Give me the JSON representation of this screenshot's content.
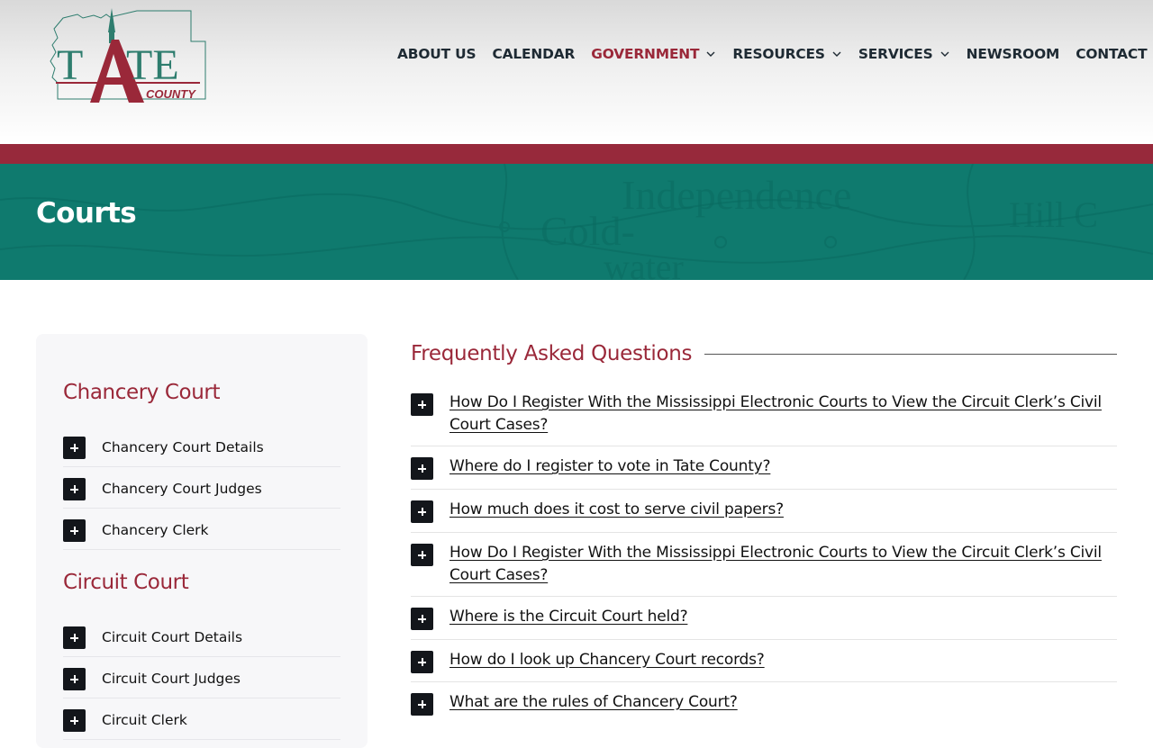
{
  "header": {
    "logo": {
      "word": "TATE",
      "sub": "COUNTY"
    },
    "nav": [
      {
        "label": "ABOUT US",
        "has_dropdown": false,
        "active": false
      },
      {
        "label": "CALENDAR",
        "has_dropdown": false,
        "active": false
      },
      {
        "label": "GOVERNMENT",
        "has_dropdown": true,
        "active": true
      },
      {
        "label": "RESOURCES",
        "has_dropdown": true,
        "active": false
      },
      {
        "label": "SERVICES",
        "has_dropdown": true,
        "active": false
      },
      {
        "label": "NEWSROOM",
        "has_dropdown": false,
        "active": false
      },
      {
        "label": "CONTACT",
        "has_dropdown": false,
        "active": false
      }
    ],
    "home_icon": "home-icon"
  },
  "banner": {
    "title": "Courts"
  },
  "sidebar": {
    "sections": [
      {
        "heading": "Chancery Court",
        "items": [
          "Chancery Court Details",
          "Chancery Court Judges",
          "Chancery Clerk"
        ]
      },
      {
        "heading": "Circuit Court",
        "items": [
          "Circuit Court Details",
          "Circuit Court Judges",
          "Circuit Clerk"
        ]
      }
    ]
  },
  "faq": {
    "title": "Frequently Asked Questions",
    "items": [
      {
        "question": "How Do I Register With the Mississippi Electronic Courts to View the Circuit Clerk’s Civil Court Cases?"
      },
      {
        "question": "Where do I register to vote in Tate County?"
      },
      {
        "question": "How much does it cost to serve civil papers?"
      },
      {
        "question": "How Do I Register With the Mississippi Electronic Courts to View the Circuit Clerk’s Civil Court Cases?"
      },
      {
        "question": "Where is the Circuit Court held?"
      },
      {
        "question": "How do I look up Chancery Court records?"
      },
      {
        "question": "What are the rules of Chancery Court?"
      }
    ]
  },
  "colors": {
    "burgundy": "#97293b",
    "teal": "#0f7a6e",
    "nav_text": "#1e2a33",
    "dark": "#13161b"
  }
}
